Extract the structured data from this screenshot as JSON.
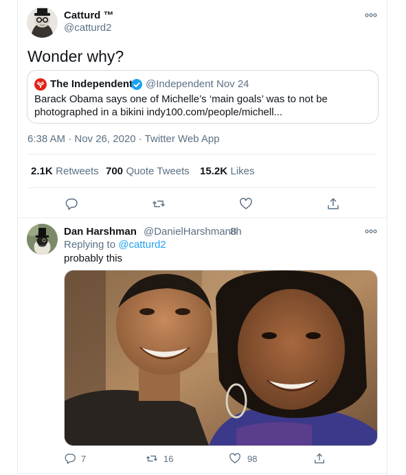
{
  "tweet": {
    "name": "Catturd ™",
    "handle": "@catturd2",
    "text": "Wonder why?",
    "quoted": {
      "name": "The Independent",
      "handle": "@Independent",
      "dot": "·",
      "date": "Nov 24",
      "line1": "Barack Obama says one of Michelle’s ‘main goals’ was to not be",
      "line2": "photographed in a bikini indy100.com/people/michell..."
    },
    "time": "6:38 AM · Nov 26, 2020 · Twitter Web App",
    "stats": [
      {
        "num": "2.1K",
        "label": "Retweets"
      },
      {
        "num": "700",
        "label": "Quote Tweets"
      },
      {
        "num": "15.2K",
        "label": "Likes"
      }
    ]
  },
  "reply": {
    "name": "Dan Harshman",
    "handle": "@DanielHarshman8",
    "dot": "·",
    "age": "8h",
    "replying_prefix": "Replying to",
    "replying_to": "@catturd2",
    "text": "probably this",
    "counts": {
      "replies": "7",
      "retweets": "16",
      "likes": "98"
    }
  },
  "colors": {
    "accent": "#1da1f2",
    "verified": "#1da1f2",
    "muted": "#5b7083",
    "independent_red": "#e2231a"
  },
  "icons": [
    "more-icon",
    "verified-icon",
    "independent-logo-icon",
    "reply-icon",
    "retweet-icon",
    "like-icon",
    "share-icon"
  ]
}
